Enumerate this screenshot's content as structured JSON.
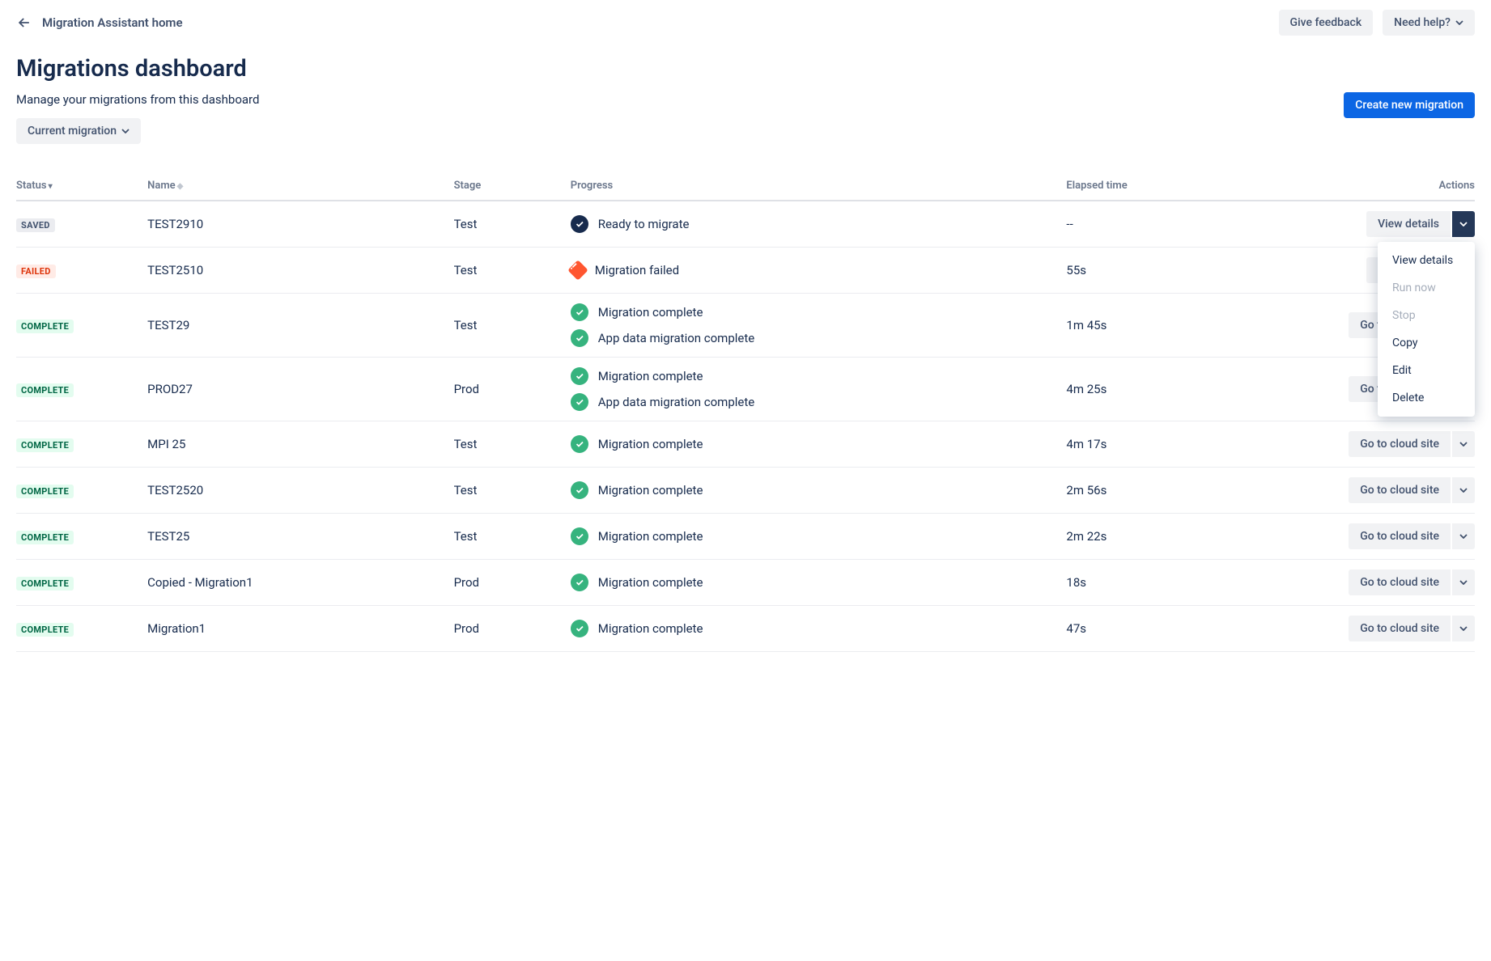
{
  "breadcrumb": {
    "home": "Migration Assistant home"
  },
  "header_actions": {
    "feedback": "Give feedback",
    "help": "Need help?"
  },
  "page": {
    "title": "Migrations dashboard",
    "subtitle": "Manage your migrations from this dashboard",
    "create_button": "Create new migration",
    "filter": "Current migration"
  },
  "table": {
    "headers": {
      "status": "Status",
      "name": "Name",
      "stage": "Stage",
      "progress": "Progress",
      "elapsed": "Elapsed time",
      "actions": "Actions"
    },
    "rows": [
      {
        "status": "SAVED",
        "status_class": "saved",
        "name": "TEST2910",
        "stage": "Test",
        "progress": [
          {
            "icon": "ready",
            "text": "Ready to migrate"
          }
        ],
        "elapsed": "--",
        "action": "View details",
        "menu_open": true
      },
      {
        "status": "FAILED",
        "status_class": "failed",
        "name": "TEST2510",
        "stage": "Test",
        "progress": [
          {
            "icon": "fail",
            "text": "Migration failed"
          }
        ],
        "elapsed": "55s",
        "action": "View details"
      },
      {
        "status": "COMPLETE",
        "status_class": "complete",
        "name": "TEST29",
        "stage": "Test",
        "progress": [
          {
            "icon": "success",
            "text": "Migration complete"
          },
          {
            "icon": "success",
            "text": "App data migration complete"
          }
        ],
        "elapsed": "1m 45s",
        "action": "Go to cloud site"
      },
      {
        "status": "COMPLETE",
        "status_class": "complete",
        "name": "PROD27",
        "stage": "Prod",
        "progress": [
          {
            "icon": "success",
            "text": "Migration complete"
          },
          {
            "icon": "success",
            "text": "App data migration complete"
          }
        ],
        "elapsed": "4m 25s",
        "action": "Go to cloud site"
      },
      {
        "status": "COMPLETE",
        "status_class": "complete",
        "name": "MPI 25",
        "stage": "Test",
        "progress": [
          {
            "icon": "success",
            "text": "Migration complete"
          }
        ],
        "elapsed": "4m 17s",
        "action": "Go to cloud site"
      },
      {
        "status": "COMPLETE",
        "status_class": "complete",
        "name": "TEST2520",
        "stage": "Test",
        "progress": [
          {
            "icon": "success",
            "text": "Migration complete"
          }
        ],
        "elapsed": "2m 56s",
        "action": "Go to cloud site"
      },
      {
        "status": "COMPLETE",
        "status_class": "complete",
        "name": "TEST25",
        "stage": "Test",
        "progress": [
          {
            "icon": "success",
            "text": "Migration complete"
          }
        ],
        "elapsed": "2m 22s",
        "action": "Go to cloud site"
      },
      {
        "status": "COMPLETE",
        "status_class": "complete",
        "name": "Copied - Migration1",
        "stage": "Prod",
        "progress": [
          {
            "icon": "success",
            "text": "Migration complete"
          }
        ],
        "elapsed": "18s",
        "action": "Go to cloud site"
      },
      {
        "status": "COMPLETE",
        "status_class": "complete",
        "name": "Migration1",
        "stage": "Prod",
        "progress": [
          {
            "icon": "success",
            "text": "Migration complete"
          }
        ],
        "elapsed": "47s",
        "action": "Go to cloud site"
      }
    ]
  },
  "dropdown_menu": [
    {
      "label": "View details",
      "disabled": false
    },
    {
      "label": "Run now",
      "disabled": true
    },
    {
      "label": "Stop",
      "disabled": true
    },
    {
      "label": "Copy",
      "disabled": false
    },
    {
      "label": "Edit",
      "disabled": false
    },
    {
      "label": "Delete",
      "disabled": false
    }
  ]
}
